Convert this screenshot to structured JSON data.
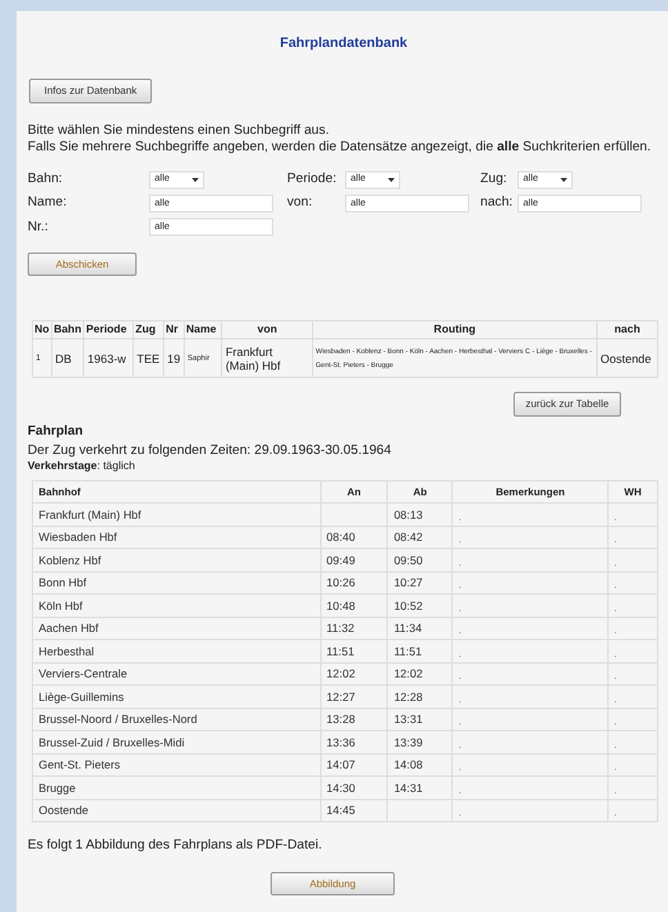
{
  "title": "Fahrplandatenbank",
  "info_button": "Infos zur Datenbank",
  "intro": [
    "Bitte wählen Sie mindestens einen Suchbegriff aus.",
    "Falls Sie mehrere Suchbegriffe angeben, werden die Datensätze angezeigt, die **alle** Suchkriterien erfüllen."
  ],
  "form_fields": [
    {
      "label": "Bahn:",
      "kind": "select",
      "value": "alle"
    },
    {
      "label": "Periode:",
      "kind": "select",
      "value": "alle"
    },
    {
      "label": "Zug:",
      "kind": "select",
      "value": "alle"
    },
    {
      "label": "Name:",
      "kind": "input",
      "value": "alle"
    },
    {
      "label": "von:",
      "kind": "input",
      "value": "alle"
    },
    {
      "label": "nach:",
      "kind": "input",
      "value": "alle"
    },
    {
      "label": "Nr.:",
      "kind": "input",
      "value": "alle"
    }
  ],
  "submit_button": "Abschicken",
  "results": {
    "columns": [
      "No",
      "Bahn",
      "Periode",
      "Zug",
      "Nr",
      "Name",
      "von",
      "Routing",
      "nach"
    ],
    "rows": [
      [
        "1",
        "DB",
        "1963-w",
        "TEE",
        "19",
        "Saphir",
        "Frankfurt (Main) Hbf",
        "Wiesbaden - Koblenz - Bonn - Köln - Aachen - Herbesthal - Verviers C - Liège - Bruxelles - Gent-St. Pieters - Brugge",
        "Oostende"
      ]
    ]
  },
  "back_button": "zurück zur Tabelle",
  "fahrplan": {
    "heading": "Fahrplan",
    "period": "Der Zug verkehrt zu folgenden Zeiten: 29.09.1963-30.05.1964",
    "days_label": "Verkehrstage",
    "days_value": ": täglich"
  },
  "timetable": {
    "columns": [
      "Bahnhof",
      "An",
      "Ab",
      "Bemerkungen",
      "WH"
    ],
    "rows": [
      [
        "Frankfurt (Main) Hbf",
        "",
        "08:13",
        ".",
        "."
      ],
      [
        "Wiesbaden Hbf",
        "08:40",
        "08:42",
        ".",
        "."
      ],
      [
        "Koblenz Hbf",
        "09:49",
        "09:50",
        ".",
        "."
      ],
      [
        "Bonn Hbf",
        "10:26",
        "10:27",
        ".",
        "."
      ],
      [
        "Köln Hbf",
        "10:48",
        "10:52",
        ".",
        "."
      ],
      [
        "Aachen Hbf",
        "11:32",
        "11:34",
        ".",
        "."
      ],
      [
        "Herbesthal",
        "11:51",
        "11:51",
        ".",
        "."
      ],
      [
        "Verviers-Centrale",
        "12:02",
        "12:02",
        ".",
        "."
      ],
      [
        "Liège-Guillemins",
        "12:27",
        "12:28",
        ".",
        "."
      ],
      [
        "Brussel-Noord / Bruxelles-Nord",
        "13:28",
        "13:31",
        ".",
        "."
      ],
      [
        "Brussel-Zuid / Bruxelles-Midi",
        "13:36",
        "13:39",
        ".",
        "."
      ],
      [
        "Gent-St. Pieters",
        "14:07",
        "14:08",
        ".",
        "."
      ],
      [
        "Brugge",
        "14:30",
        "14:31",
        ".",
        "."
      ],
      [
        "Oostende",
        "14:45",
        "",
        ".",
        "."
      ]
    ]
  },
  "footer_note": "Es folgt 1 Abbildung des Fahrplans als PDF-Datei.",
  "image_button": "Abbildung"
}
